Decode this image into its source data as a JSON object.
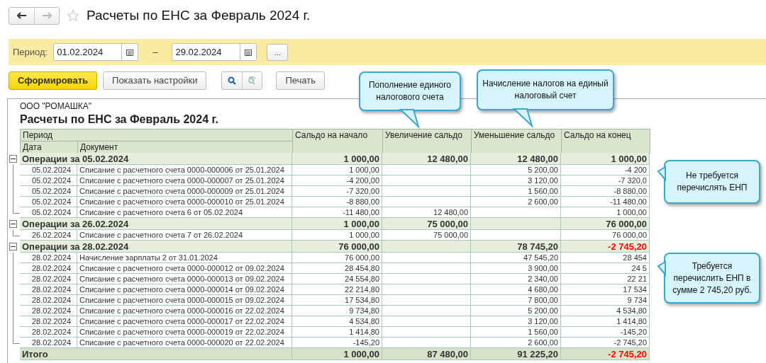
{
  "window": {
    "title": "Расчеты по ЕНС за Февраль 2024 г.",
    "favorite": false
  },
  "period": {
    "label": "Период:",
    "from": "01.02.2024",
    "separator": "–",
    "to": "29.02.2024",
    "more": "..."
  },
  "toolbar": {
    "generate": "Сформировать",
    "settings": "Показать настройки",
    "print": "Печать"
  },
  "report": {
    "company": "ООО \"РОМАШКА\"",
    "title": "Расчеты по ЕНС за Февраль 2024 г.",
    "columns": {
      "period": "Период",
      "date": "Дата",
      "document": "Документ",
      "start": "Сальдо на начало",
      "increase": "Увеличение сальдо",
      "decrease": "Уменьшение сальдо",
      "end": "Сальдо на конец"
    },
    "groups": [
      {
        "label": "Операции за 05.02.2024",
        "expanded": true,
        "start": "1 000,00",
        "increase": "12 480,00",
        "decrease": "12 480,00",
        "end": "1 000,00",
        "alert": false,
        "rows": [
          {
            "date": "05.02.2024",
            "document": "Списание с расчетного счета 0000-000006 от 25.01.2024",
            "start": "1 000,00",
            "decrease": "5 200,00",
            "end": "-4 200"
          },
          {
            "date": "05.02.2024",
            "document": "Списание с расчетного счета 0000-000007 от 25.01.2024",
            "start": "-4 200,00",
            "decrease": "3 120,00",
            "end": "-7 320,0"
          },
          {
            "date": "05.02.2024",
            "document": "Списание с расчетного счета 0000-000009 от 25.01.2024",
            "start": "-7 320,00",
            "decrease": "1 560,00",
            "end": "-8 880,00"
          },
          {
            "date": "05.02.2024",
            "document": "Списание с расчетного счета 0000-000010 от 25.01.2024",
            "start": "-8 880,00",
            "decrease": "2 600,00",
            "end": "-11 480,00"
          },
          {
            "date": "05.02.2024",
            "document": "Списание с расчетного счета 6 от 05.02.2024",
            "start": "-11 480,00",
            "increase": "12 480,00",
            "end": "1 000,00"
          }
        ]
      },
      {
        "label": "Операции за 26.02.2024",
        "expanded": true,
        "start": "1 000,00",
        "increase": "75 000,00",
        "end": "76 000,00",
        "alert": false,
        "rows": [
          {
            "date": "26.02.2024",
            "document": "Списание с расчетного счета 7 от 26.02.2024",
            "start": "1 000,00",
            "increase": "75 000,00",
            "end": "76 000,00"
          }
        ]
      },
      {
        "label": "Операции за 28.02.2024",
        "expanded": true,
        "start": "76 000,00",
        "decrease": "78 745,20",
        "end": "-2 745,20",
        "alert": true,
        "rows": [
          {
            "date": "28.02.2024",
            "document": "Начисление зарплаты 2 от 31.01.2024",
            "start": "76 000,00",
            "decrease": "47 545,20",
            "end": "28 454"
          },
          {
            "date": "28.02.2024",
            "document": "Списание с расчетного счета 0000-000012 от 09.02.2024",
            "start": "28 454,80",
            "decrease": "3 900,00",
            "end": "24 5"
          },
          {
            "date": "28.02.2024",
            "document": "Списание с расчетного счета 0000-000013 от 09.02.2024",
            "start": "24 554,80",
            "decrease": "2 340,00",
            "end": "22 21"
          },
          {
            "date": "28.02.2024",
            "document": "Списание с расчетного счета 0000-000014 от 09.02.2024",
            "start": "22 214,80",
            "decrease": "4 680,00",
            "end": "17 534"
          },
          {
            "date": "28.02.2024",
            "document": "Списание с расчетного счета 0000-000015 от 09.02.2024",
            "start": "17 534,80",
            "decrease": "7 800,00",
            "end": "9 734"
          },
          {
            "date": "28.02.2024",
            "document": "Списание с расчетного счета 0000-000016 от 22.02.2024",
            "start": "9 734,80",
            "decrease": "5 200,00",
            "end": "4 534,80"
          },
          {
            "date": "28.02.2024",
            "document": "Списание с расчетного счета 0000-000017 от 22.02.2024",
            "start": "4 534,80",
            "decrease": "3 120,00",
            "end": "1 414,80"
          },
          {
            "date": "28.02.2024",
            "document": "Списание с расчетного счета 0000-000019 от 22.02.2024",
            "start": "1 414,80",
            "decrease": "1 560,00",
            "end": "-145,20"
          },
          {
            "date": "28.02.2024",
            "document": "Списание с расчетного счета 0000-000020 от 22.02.2024",
            "start": "-145,20",
            "decrease": "2 600,00",
            "end": "-2 745,20"
          }
        ]
      }
    ],
    "total": {
      "label": "Итого",
      "start": "1 000,00",
      "increase": "87 480,00",
      "decrease": "91 225,20",
      "end": "-2 745,20",
      "alert": true
    }
  },
  "callouts": [
    {
      "kind": "down",
      "text": "Пополнение единого налогового счета"
    },
    {
      "kind": "down",
      "text": "Начисление налогов на единый налоговый счет"
    },
    {
      "kind": "left",
      "text": "Не требуется перечислять ЕНП"
    },
    {
      "kind": "left",
      "text": "Требуется перечислить ЕНП в сумме 2 745,20 руб."
    }
  ]
}
